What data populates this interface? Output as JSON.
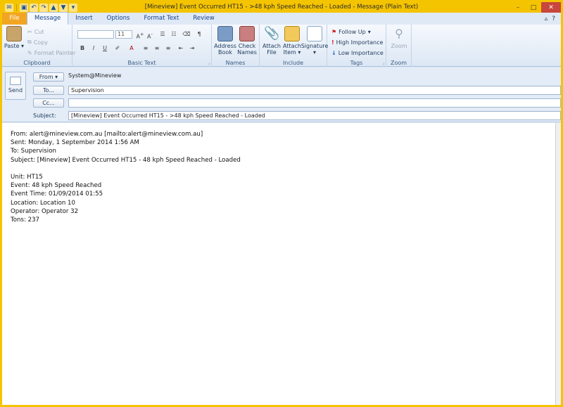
{
  "window": {
    "title": "[Mineview] Event Occurred HT15 - >48 kph Speed Reached - Loaded - Message (Plain Text)"
  },
  "tabs": [
    {
      "label": "File"
    },
    {
      "label": "Message"
    },
    {
      "label": "Insert"
    },
    {
      "label": "Options"
    },
    {
      "label": "Format Text"
    },
    {
      "label": "Review"
    }
  ],
  "ribbon": {
    "clipboard": {
      "paste": "Paste",
      "cut": "Cut",
      "copy": "Copy",
      "format_painter": "Format Painter",
      "label": "Clipboard"
    },
    "basic_text": {
      "font_size": "11",
      "label": "Basic Text"
    },
    "names": {
      "address_book": "Address Book",
      "check_names": "Check Names",
      "label": "Names"
    },
    "include": {
      "attach_file": "Attach File",
      "attach_item": "Attach Item",
      "signature": "Signature",
      "label": "Include"
    },
    "tags": {
      "follow_up": "Follow Up",
      "high_importance": "High Importance",
      "low_importance": "Low Importance",
      "label": "Tags"
    },
    "zoom": {
      "zoom": "Zoom",
      "label": "Zoom"
    }
  },
  "header": {
    "send": "Send",
    "from_label": "From ▾",
    "from_value": "System@Mineview",
    "to_label": "To...",
    "to_value": "Supervision",
    "cc_label": "Cc...",
    "cc_value": "",
    "subject_label": "Subject:",
    "subject_value": "[Mineview] Event Occurred HT15 - >48 kph Speed Reached - Loaded"
  },
  "body": {
    "lines": [
      "From: alert@mineview.com.au [mailto:alert@mineview.com.au]",
      "Sent: Monday, 1 September 2014 1:56 AM",
      "To: Supervision",
      "Subject: [Mineview] Event Occurred HT15 - 48 kph Speed Reached - Loaded",
      "",
      "Unit: HT15",
      "Event: 48 kph Speed Reached",
      "Event Time: 01/09/2014 01:55",
      "Location: Location 10",
      "Operator: Operator 32",
      "Tons: 237"
    ]
  }
}
